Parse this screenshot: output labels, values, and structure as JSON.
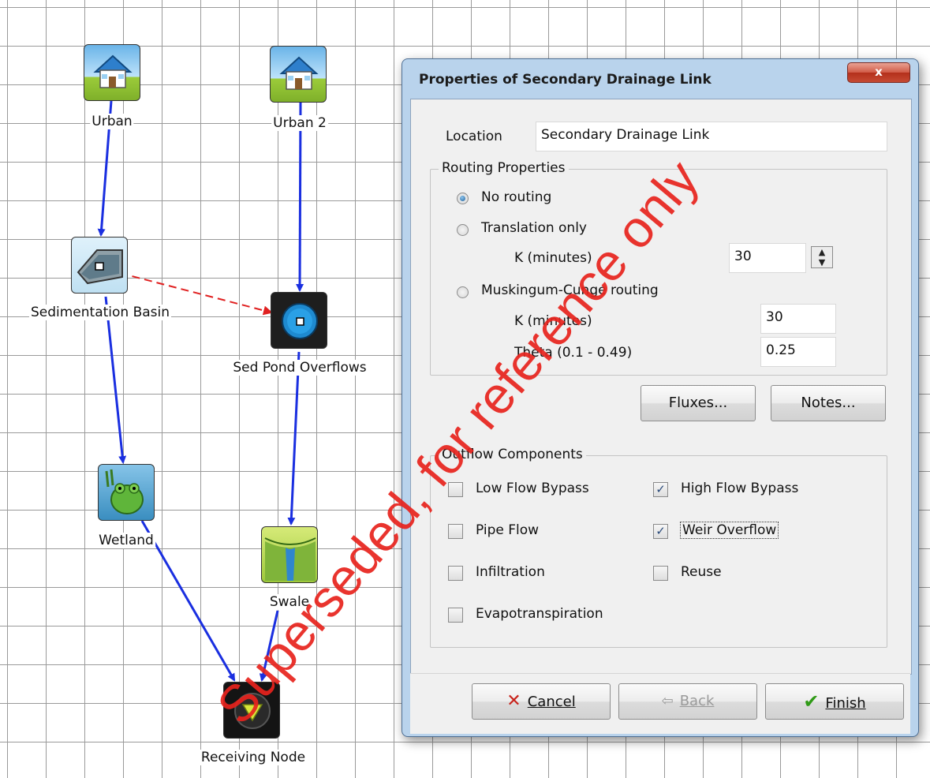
{
  "canvas": {
    "nodes": {
      "urban": "Urban",
      "urban2": "Urban 2",
      "sedimentation": "Sedimentation Basin",
      "sedpond": "Sed Pond Overflows",
      "wetland": "Wetland",
      "swale": "Swale",
      "receiving": "Receiving Node"
    },
    "link_colors": {
      "primary": "#1a2fe0",
      "secondary": "#e02020"
    }
  },
  "dialog": {
    "title": "Properties of Secondary Drainage Link",
    "close_label": "x",
    "location_label": "Location",
    "location_value": "Secondary Drainage Link",
    "routing": {
      "title": "Routing Properties",
      "no_routing": "No routing",
      "translation_only": "Translation only",
      "k_minutes_label": "K (minutes)",
      "translation_k_value": "30",
      "muskingum": "Muskingum-Cunge routing",
      "muskingum_k_label": "K (minutes)",
      "muskingum_k_value": "30",
      "theta_label": "Theta (0.1 - 0.49)",
      "theta_value": "0.25",
      "selected": "no_routing"
    },
    "fluxes_button": "Fluxes...",
    "notes_button": "Notes...",
    "outflow": {
      "title": "Outflow Components",
      "low_flow_bypass": "Low Flow Bypass",
      "high_flow_bypass": "High Flow Bypass",
      "pipe_flow": "Pipe Flow",
      "weir_overflow": "Weir Overflow",
      "infiltration": "Infiltration",
      "reuse": "Reuse",
      "evapotranspiration": "Evapotranspiration",
      "checked_mark": "✓",
      "unchecked_mark": ""
    },
    "cancel_button": "Cancel",
    "back_button": "Back",
    "finish_button": "Finish"
  },
  "watermark": "Superseded, for reference only"
}
